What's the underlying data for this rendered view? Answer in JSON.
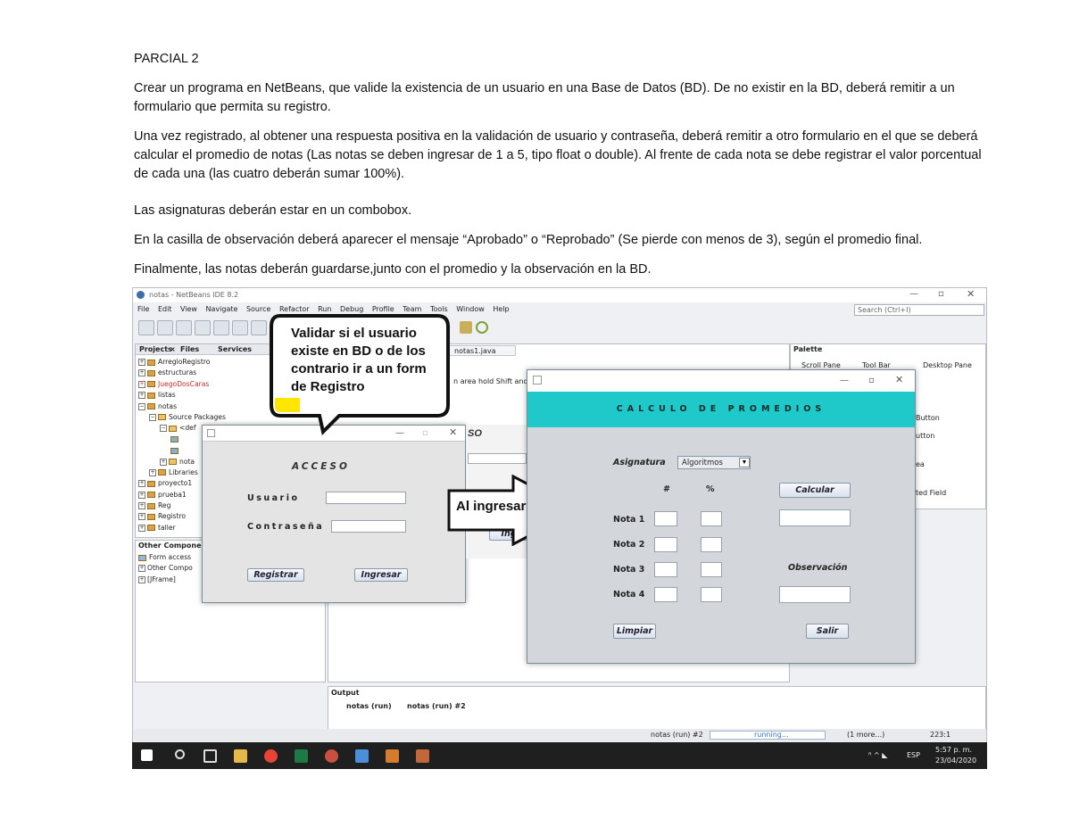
{
  "document": {
    "heading": "PARCIAL 2",
    "paragraphs": [
      "Crear un programa en NetBeans, que valide la existencia de un usuario en una Base de Datos (BD). De no existir en la BD, deberá remitir a un formulario que permita su registro.",
      "Una vez registrado, al obtener una respuesta positiva en la validación de usuario y contraseña, deberá remitir a otro formulario en el que se deberá calcular el promedio de notas (Las notas se deben ingresar de 1 a 5, tipo float o double). Al frente de cada nota se debe registrar el valor porcentual de cada una (las cuatro deberán sumar 100%).",
      "Las asignaturas deberán estar en un combobox.",
      "En la casilla de observación deberá aparecer el mensaje “Aprobado” o “Reprobado” (Se pierde con menos de 3), según el promedio final.",
      "Finalmente, las notas deberán guardarse,junto con el promedio y la observación en la BD."
    ]
  },
  "ide": {
    "title": "notas - NetBeans IDE 8.2",
    "menu": [
      "File",
      "Edit",
      "View",
      "Navigate",
      "Source",
      "Refactor",
      "Run",
      "Debug",
      "Profile",
      "Team",
      "Tools",
      "Window",
      "Help"
    ],
    "search_placeholder": "Search (Ctrl+I)",
    "panel_tabs": [
      "Projects",
      "Files",
      "Services"
    ],
    "projects": [
      "ArregloRegistro",
      "estructuras",
      "JuegoDosCaras",
      "listas",
      "notas",
      "Source Packages",
      "<def",
      "",
      "",
      "nota",
      "Libraries",
      "proyecto1",
      "prueba1",
      "Reg",
      "Registro",
      "taller"
    ],
    "navigator_title": "Other Components",
    "navigator_items": [
      "Form access",
      "Other Compo",
      "[JFrame]"
    ],
    "editor_tab": "notas1.java",
    "editor_hint": "n area hold Shift and drag",
    "palette_title": "Palette",
    "palette_items": [
      "Scroll Pane",
      "Tool Bar",
      "Desktop Pane"
    ],
    "palette_side": [
      "Button",
      "utton",
      "ea",
      "ted Field"
    ],
    "output_title": "Output",
    "output_tabs": [
      "notas (run)",
      "notas (run) #2"
    ],
    "status_left": "notas (run) #2",
    "status_running": "running...",
    "status_more": "(1 more...)",
    "status_pos": "223:1"
  },
  "callout": {
    "text": "Validar si el usuario existe en BD o de los contrario ir a un form de Registro"
  },
  "arrow": {
    "text": "Al ingresar"
  },
  "acceso": {
    "title": "ACCESO",
    "usuario_label": "Usuario",
    "password_label": "Contraseña",
    "registrar": "Registrar",
    "ingresar": "Ingresar",
    "behind_text": "SO",
    "behind_btn": "Ing"
  },
  "promedios": {
    "title": "CALCULO DE PROMEDIOS",
    "asignatura_label": "Asignatura",
    "asignatura_value": "Algoritmos",
    "col_num": "#",
    "col_pct": "%",
    "notas": [
      "Nota 1",
      "Nota 2",
      "Nota 3",
      "Nota 4"
    ],
    "calcular": "Calcular",
    "observacion": "Observación",
    "limpiar": "Limpiar",
    "salir": "Salir"
  },
  "taskbar": {
    "lang": "ESP",
    "time": "5:57 p. m.",
    "date": "23/04/2020"
  },
  "colors": {
    "teal": "#1fc9c9",
    "callout_yellow": "#ffe500",
    "form_bg": "#e4e4e4",
    "promedio_bg": "#d3d7dc"
  }
}
